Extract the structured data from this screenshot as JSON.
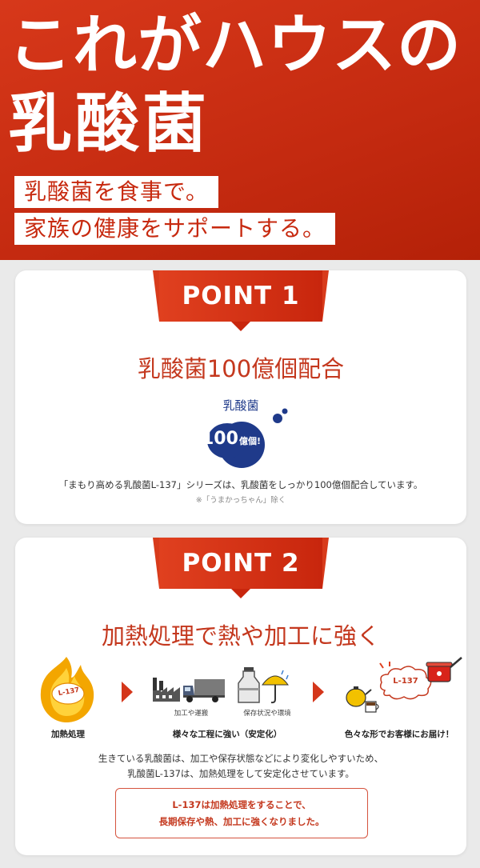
{
  "hero": {
    "line1": "これがハウスの",
    "line2": "乳酸菌",
    "sub1": "乳酸菌を食事で。",
    "sub2": "家族の健康をサポートする。"
  },
  "point1": {
    "badge": "POINT 1",
    "heading": "乳酸菌100億個配合",
    "icon_top": "乳酸菌",
    "icon_num": "100",
    "icon_unit": "億個!",
    "note": "「まもり高める乳酸菌L-137」シリーズは、乳酸菌をしっかり100億個配合しています。",
    "footnote": "※「うまかっちゃん」除く"
  },
  "point2": {
    "badge": "POINT 2",
    "heading": "加熱処理で熱や加工に強く",
    "flame_label": "L-137",
    "cloud_label": "L-137",
    "step1": "加熱処理",
    "step2": "様々な工程に強い（安定化）",
    "step2_cap_a": "加工や運搬",
    "step2_cap_b": "保存状況や環境",
    "step3": "色々な形でお客様にお届け！",
    "body1": "生きている乳酸菌は、加工や保存状態などにより変化しやすいため、",
    "body2": "乳酸菌L-137は、加熱処理をして安定化させています。",
    "box1": "L-137は加熱処理をすることで、",
    "box2": "長期保存や熱、加工に強くなりました。"
  },
  "colors": {
    "brand_red": "#c7290f",
    "accent_red": "#c4381e",
    "navy": "#1f3a8a"
  },
  "icons": [
    "factory-icon",
    "truck-icon",
    "milk-can-icon",
    "umbrella-icon",
    "teapot-icon",
    "mug-icon",
    "pot-icon"
  ]
}
